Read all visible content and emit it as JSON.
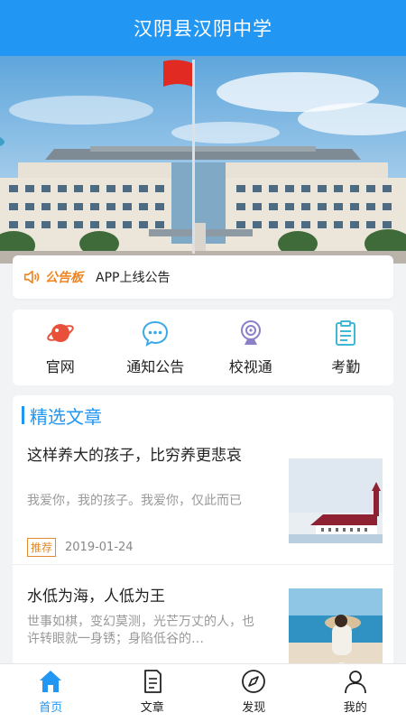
{
  "header": {
    "title": "汉阴县汉阴中学"
  },
  "notice": {
    "tag": "公告板",
    "text": "APP上线公告"
  },
  "quick_links": [
    {
      "label": "官网",
      "icon": "planet-icon",
      "color": "#e8503a"
    },
    {
      "label": "通知公告",
      "icon": "chat-bubble-icon",
      "color": "#39a9e8"
    },
    {
      "label": "校视通",
      "icon": "webcam-icon",
      "color": "#8b7fc8"
    },
    {
      "label": "考勤",
      "icon": "clipboard-icon",
      "color": "#3fb8d6"
    }
  ],
  "section": {
    "title": "精选文章"
  },
  "articles": [
    {
      "title": "这样养大的孩子，比穷养更悲哀",
      "summary": "我爱你，我的孩子。我爱你，仅此而已",
      "tag": "推荐",
      "date": "2019-01-24"
    },
    {
      "title": "水低为海，人低为王",
      "summary": "世事如棋，变幻莫测，光芒万丈的人，也许转眼就一身锈；身陷低谷的…"
    }
  ],
  "tabs": [
    {
      "label": "首页",
      "icon": "home-icon",
      "active": true
    },
    {
      "label": "文章",
      "icon": "document-icon",
      "active": false
    },
    {
      "label": "发现",
      "icon": "compass-icon",
      "active": false
    },
    {
      "label": "我的",
      "icon": "user-icon",
      "active": false
    }
  ],
  "colors": {
    "primary": "#2196f3",
    "accent": "#f0841f"
  }
}
